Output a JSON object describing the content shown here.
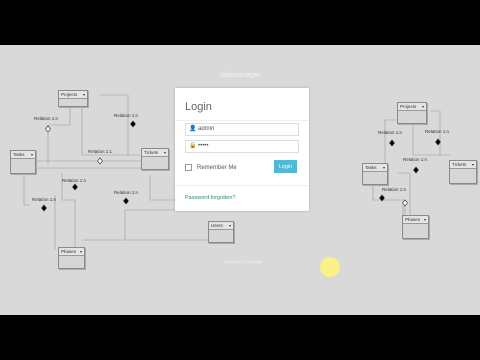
{
  "app_title": "taskmanager",
  "overlay_text": "Copyright © Arcology",
  "login": {
    "title": "Login",
    "username_value": "admin",
    "password_value": "•••••",
    "remember_label": "Remember Me",
    "login_button": "Login",
    "forgot_link": "Password forgotten?"
  },
  "diagram_left": {
    "entities": [
      "Projects",
      "Tasks",
      "Tickets",
      "Phases",
      "Users"
    ],
    "relations": [
      "Relation 1:n",
      "Relation 1:n",
      "Relation 1:1",
      "Relation 1:n",
      "Relation 1:n",
      "Relation 1:n"
    ]
  },
  "diagram_right": {
    "entities": [
      "Projects",
      "Tasks",
      "Tickets",
      "Phases"
    ],
    "relations": [
      "Relation 1:n",
      "Relation 1:n",
      "Relation 1:n",
      "Relation 1:n"
    ]
  }
}
